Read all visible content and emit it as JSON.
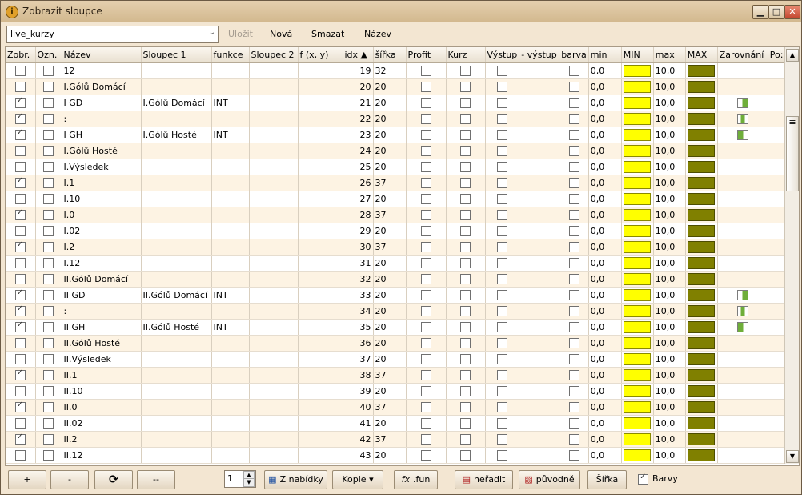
{
  "window": {
    "title": "Zobrazit sloupce"
  },
  "toolbar": {
    "combo_value": "live_kurzy",
    "save_label": "Uložit",
    "new_label": "Nová",
    "delete_label": "Smazat",
    "name_label": "Název"
  },
  "columns": [
    "Zobr.",
    "Ozn.",
    "Název",
    "Sloupec 1",
    "funkce",
    "Sloupec 2",
    "f (x, y)",
    "idx ▲",
    "šířka",
    "Profit",
    "Kurz",
    "Výstup",
    "- výstup",
    "barva",
    "min",
    "MIN",
    "max",
    "MAX",
    "Zarovnání",
    "Po:"
  ],
  "rows": [
    {
      "zobr": false,
      "name": "12",
      "bold": true,
      "s1": "",
      "fn": "",
      "idx": "19",
      "width": "32",
      "min": "0,0",
      "max": "10,0",
      "align": ""
    },
    {
      "zobr": false,
      "name": "I.Gólů Domácí",
      "bold": true,
      "s1": "",
      "fn": "",
      "idx": "20",
      "width": "20",
      "min": "0,0",
      "max": "10,0",
      "align": ""
    },
    {
      "zobr": true,
      "name": "I GD",
      "bold": false,
      "s1": "I.Gólů Domácí",
      "fn": "INT",
      "idx": "21",
      "width": "20",
      "min": "0,0",
      "max": "10,0",
      "align": "right"
    },
    {
      "zobr": true,
      "name": ":",
      "bold": true,
      "s1": "",
      "fn": "",
      "idx": "22",
      "width": "20",
      "min": "0,0",
      "max": "10,0",
      "align": "center"
    },
    {
      "zobr": true,
      "name": "I GH",
      "bold": false,
      "s1": "I.Gólů Hosté",
      "fn": "INT",
      "idx": "23",
      "width": "20",
      "min": "0,0",
      "max": "10,0",
      "align": "left"
    },
    {
      "zobr": false,
      "name": "I.Gólů Hosté",
      "bold": true,
      "s1": "",
      "fn": "",
      "idx": "24",
      "width": "20",
      "min": "0,0",
      "max": "10,0",
      "align": ""
    },
    {
      "zobr": false,
      "name": "I.Výsledek",
      "bold": true,
      "s1": "",
      "fn": "",
      "idx": "25",
      "width": "20",
      "min": "0,0",
      "max": "10,0",
      "align": ""
    },
    {
      "zobr": true,
      "name": "I.1",
      "bold": true,
      "s1": "",
      "fn": "",
      "idx": "26",
      "width": "37",
      "min": "0,0",
      "max": "10,0",
      "align": ""
    },
    {
      "zobr": false,
      "name": "I.10",
      "bold": true,
      "s1": "",
      "fn": "",
      "idx": "27",
      "width": "20",
      "min": "0,0",
      "max": "10,0",
      "align": ""
    },
    {
      "zobr": true,
      "name": "I.0",
      "bold": true,
      "s1": "",
      "fn": "",
      "idx": "28",
      "width": "37",
      "min": "0,0",
      "max": "10,0",
      "align": ""
    },
    {
      "zobr": false,
      "name": "I.02",
      "bold": true,
      "s1": "",
      "fn": "",
      "idx": "29",
      "width": "20",
      "min": "0,0",
      "max": "10,0",
      "align": ""
    },
    {
      "zobr": true,
      "name": "I.2",
      "bold": true,
      "s1": "",
      "fn": "",
      "idx": "30",
      "width": "37",
      "min": "0,0",
      "max": "10,0",
      "align": ""
    },
    {
      "zobr": false,
      "name": "I.12",
      "bold": true,
      "s1": "",
      "fn": "",
      "idx": "31",
      "width": "20",
      "min": "0,0",
      "max": "10,0",
      "align": ""
    },
    {
      "zobr": false,
      "name": "II.Gólů Domácí",
      "bold": true,
      "s1": "",
      "fn": "",
      "idx": "32",
      "width": "20",
      "min": "0,0",
      "max": "10,0",
      "align": ""
    },
    {
      "zobr": true,
      "name": "II GD",
      "bold": false,
      "s1": "II.Gólů Domácí",
      "fn": "INT",
      "idx": "33",
      "width": "20",
      "min": "0,0",
      "max": "10,0",
      "align": "right"
    },
    {
      "zobr": true,
      "name": ":",
      "bold": true,
      "s1": "",
      "fn": "",
      "idx": "34",
      "width": "20",
      "min": "0,0",
      "max": "10,0",
      "align": "center"
    },
    {
      "zobr": true,
      "name": "II GH",
      "bold": false,
      "s1": "II.Gólů Hosté",
      "fn": "INT",
      "idx": "35",
      "width": "20",
      "min": "0,0",
      "max": "10,0",
      "align": "left"
    },
    {
      "zobr": false,
      "name": "II.Gólů Hosté",
      "bold": true,
      "s1": "",
      "fn": "",
      "idx": "36",
      "width": "20",
      "min": "0,0",
      "max": "10,0",
      "align": ""
    },
    {
      "zobr": false,
      "name": "II.Výsledek",
      "bold": true,
      "s1": "",
      "fn": "",
      "idx": "37",
      "width": "20",
      "min": "0,0",
      "max": "10,0",
      "align": ""
    },
    {
      "zobr": true,
      "name": "II.1",
      "bold": true,
      "s1": "",
      "fn": "",
      "idx": "38",
      "width": "37",
      "min": "0,0",
      "max": "10,0",
      "align": ""
    },
    {
      "zobr": false,
      "name": "II.10",
      "bold": true,
      "s1": "",
      "fn": "",
      "idx": "39",
      "width": "20",
      "min": "0,0",
      "max": "10,0",
      "align": ""
    },
    {
      "zobr": true,
      "name": "II.0",
      "bold": true,
      "s1": "",
      "fn": "",
      "idx": "40",
      "width": "37",
      "min": "0,0",
      "max": "10,0",
      "align": ""
    },
    {
      "zobr": false,
      "name": "II.02",
      "bold": true,
      "s1": "",
      "fn": "",
      "idx": "41",
      "width": "20",
      "min": "0,0",
      "max": "10,0",
      "align": ""
    },
    {
      "zobr": true,
      "name": "II.2",
      "bold": true,
      "s1": "",
      "fn": "",
      "idx": "42",
      "width": "37",
      "min": "0,0",
      "max": "10,0",
      "align": ""
    },
    {
      "zobr": false,
      "name": "II.12",
      "bold": true,
      "s1": "",
      "fn": "",
      "idx": "43",
      "width": "20",
      "min": "0,0",
      "max": "10,0",
      "align": ""
    }
  ],
  "colors": {
    "min_swatch": "#ffff00",
    "max_swatch": "#808000",
    "row_alt": "#fdf3e3"
  },
  "bottom": {
    "plus_label": "+",
    "minus_label": "-",
    "refresh_icon": "refresh-icon",
    "dashdash_label": "--",
    "spin_value": "1",
    "menu_label": "Z nabídky",
    "copy_label": "Kopie ▾",
    "fun_label": ".fun",
    "sort_label": "neřadit",
    "original_label": "původně",
    "width_label": "Šířka",
    "colors_label": "Barvy",
    "colors_checked": true
  }
}
